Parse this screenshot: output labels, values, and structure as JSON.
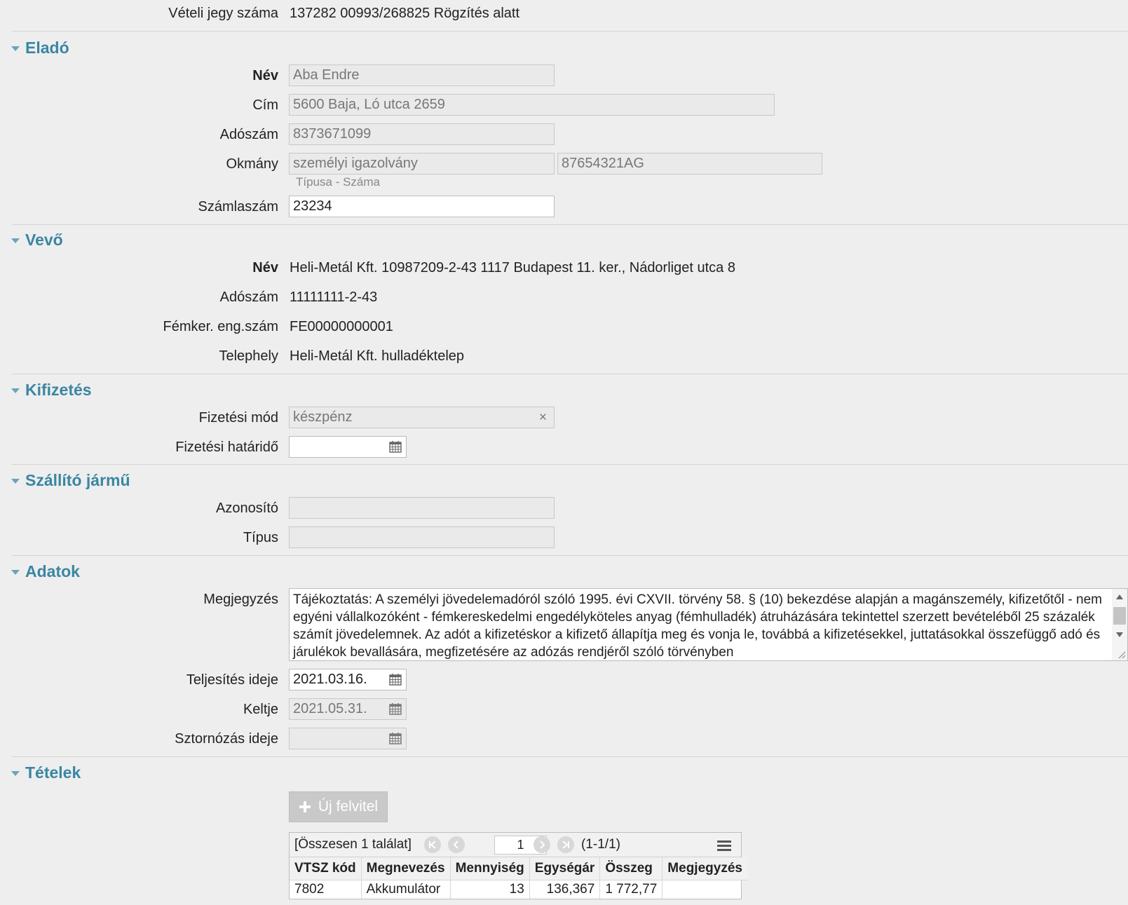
{
  "header": {
    "ticket_label": "Vételi jegy száma",
    "ticket_value": "137282 00993/268825 Rögzítés alatt"
  },
  "seller": {
    "title": "Eladó",
    "name_label": "Név",
    "name_value": "Aba Endre",
    "address_label": "Cím",
    "address_value": "5600 Baja, Ló utca 2659",
    "tax_label": "Adószám",
    "tax_value": "8373671099",
    "doc_label": "Okmány",
    "doc_type": "személyi igazolvány",
    "doc_number": "87654321AG",
    "doc_hint": "Típusa - Száma",
    "account_label": "Számlaszám",
    "account_value": "23234"
  },
  "buyer": {
    "title": "Vevő",
    "name_label": "Név",
    "name_value": "Heli-Metál Kft. 10987209-2-43 1117 Budapest 11. ker., Nádorliget utca 8",
    "tax_label": "Adószám",
    "tax_value": "11111111-2-43",
    "permit_label": "Fémker. eng.szám",
    "permit_value": "FE00000000001",
    "site_label": "Telephely",
    "site_value": "Heli-Metál Kft. hulladéktelep"
  },
  "payment": {
    "title": "Kifizetés",
    "method_label": "Fizetési mód",
    "method_value": "készpénz",
    "deadline_label": "Fizetési határidő",
    "deadline_value": ""
  },
  "vehicle": {
    "title": "Szállító jármű",
    "id_label": "Azonosító",
    "id_value": "",
    "type_label": "Típus",
    "type_value": ""
  },
  "details": {
    "title": "Adatok",
    "note_label": "Megjegyzés",
    "note_value": "Tájékoztatás: A személyi jövedelemadóról szóló 1995. évi CXVII. törvény 58. § (10) bekezdése alapján a magánszemély, kifizetőtől - nem egyéni vállalkozóként - fémkereskedelmi engedélyköteles anyag (fémhulladék) átruházására tekintettel szerzett bevételéből 25 százalék számít jövedelemnek. Az adót a kifizetéskor a kifizető állapítja meg és vonja le, továbbá a kifizetésekkel, juttatásokkal összefüggő adó és járulékok bevallására, megfizetésére az adózás rendjéről szóló törvényben",
    "completion_label": "Teljesítés ideje",
    "completion_value": "2021.03.16.",
    "date_label": "Keltje",
    "date_value": "2021.05.31.",
    "storno_label": "Sztornózás ideje",
    "storno_value": ""
  },
  "items": {
    "title": "Tételek",
    "new_button": "Új felvitel",
    "total_text": "[Összesen 1 találat]",
    "page_value": "1",
    "page_range": "(1-1/1)",
    "columns": [
      "VTSZ kód",
      "Megnevezés",
      "Mennyiség",
      "Egységár",
      "Összeg",
      "Megjegyzés"
    ],
    "rows": [
      [
        "7802",
        "Akkumulátor",
        "13",
        "136,367",
        "1 772,77",
        ""
      ]
    ]
  }
}
